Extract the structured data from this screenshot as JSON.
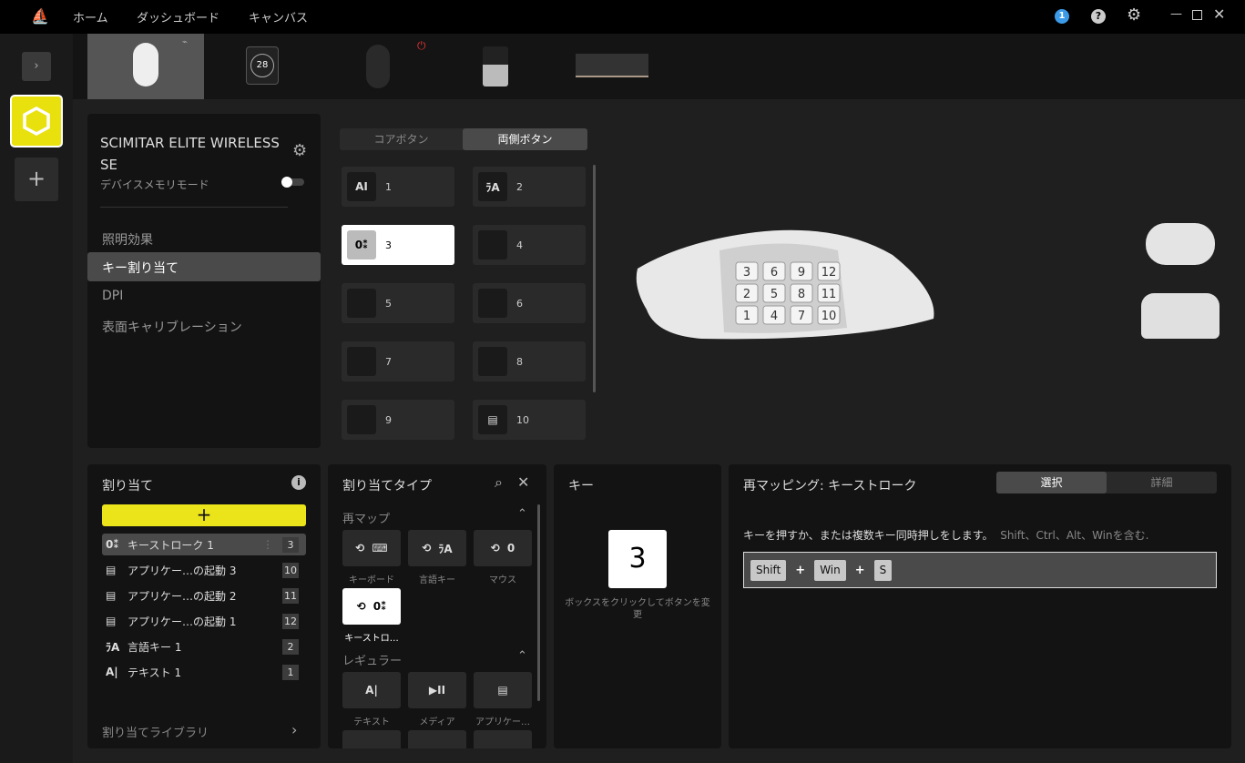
{
  "nav": {
    "home": "ホーム",
    "dashboard": "ダッシュボード",
    "canvas": "キャンバス",
    "notification_count": "1"
  },
  "devices": [
    {
      "name": "mouse-white"
    },
    {
      "name": "cooler",
      "display": "28"
    },
    {
      "name": "mouse-black"
    },
    {
      "name": "dongle"
    },
    {
      "name": "memory"
    }
  ],
  "device": {
    "name": "SCIMITAR ELITE WIRELESS SE",
    "memory_mode": "デバイスメモリモード",
    "memory_mode_on": false,
    "menu": [
      "照明効果",
      "キー割り当て",
      "DPI",
      "表面キャリブレーション"
    ],
    "active_menu": "キー割り当て"
  },
  "button_tabs": {
    "core": "コアボタン",
    "sides": "両側ボタン",
    "active": "両側ボタン"
  },
  "buttons": [
    {
      "label": "1",
      "icon": "AI"
    },
    {
      "label": "2",
      "icon": "ﾗA"
    },
    {
      "label": "3",
      "icon": "0⁑"
    },
    {
      "label": "4",
      "icon": ""
    },
    {
      "label": "5",
      "icon": ""
    },
    {
      "label": "6",
      "icon": ""
    },
    {
      "label": "7",
      "icon": ""
    },
    {
      "label": "8",
      "icon": ""
    },
    {
      "label": "9",
      "icon": ""
    },
    {
      "label": "10",
      "icon": "▤"
    }
  ],
  "mouse_keys": [
    [
      "3",
      "6",
      "9",
      "12"
    ],
    [
      "2",
      "5",
      "8",
      "11"
    ],
    [
      "1",
      "4",
      "7",
      "10"
    ]
  ],
  "assignments": {
    "title": "割り当て",
    "add": "+",
    "library": "割り当てライブラリ",
    "items": [
      {
        "icon": "0⁑",
        "name": "キーストローク 1",
        "badge": "3"
      },
      {
        "icon": "▤",
        "name": "アプリケー…の起動 3",
        "badge": "10"
      },
      {
        "icon": "▤",
        "name": "アプリケー…の起動 2",
        "badge": "11"
      },
      {
        "icon": "▤",
        "name": "アプリケー…の起動 1",
        "badge": "12"
      },
      {
        "icon": "ﾗA",
        "name": "言語キー 1",
        "badge": "2"
      },
      {
        "icon": "A|",
        "name": "テキスト 1",
        "badge": "1"
      }
    ]
  },
  "types": {
    "title": "割り当てタイプ",
    "remap": "再マップ",
    "regular": "レギュラー",
    "remap_items": [
      {
        "icon": "⌨",
        "label": "キーボード"
      },
      {
        "icon": "ﾗA",
        "label": "言語キー"
      },
      {
        "icon": "0",
        "label": "マウス"
      },
      {
        "icon": "0⁑",
        "label": "キーストロ…"
      }
    ],
    "regular_items": [
      {
        "icon": "A|",
        "label": "テキスト"
      },
      {
        "icon": "▶II",
        "label": "メディア"
      },
      {
        "icon": "▤",
        "label": "アプリケー…"
      }
    ]
  },
  "key": {
    "title": "キー",
    "value": "3",
    "hint": "ボックスをクリックしてボタンを変更"
  },
  "remap": {
    "title": "再マッピング: キーストローク",
    "tab_select": "選択",
    "tab_detail": "詳細",
    "instruction": "キーを押すか、または複数キー同時押しをします。",
    "instruction_note": "Shift、Ctrl、Alt、Winを含む.",
    "keys": [
      "Shift",
      "Win",
      "S"
    ],
    "plus": "+"
  }
}
